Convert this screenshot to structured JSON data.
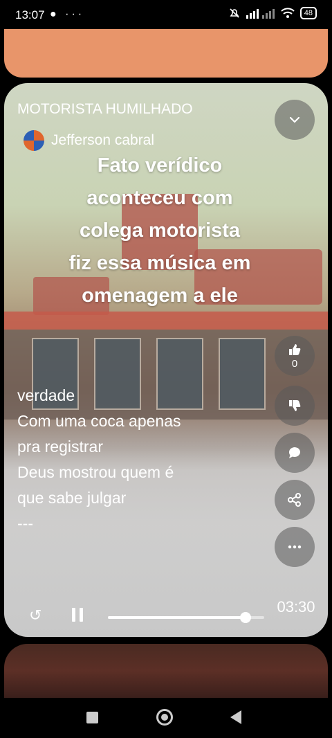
{
  "status": {
    "time": "13:07",
    "left_icons": "● ···",
    "battery": "48"
  },
  "card": {
    "title": "MOTORISTA HUMILHADO",
    "author": "Jefferson cabral",
    "overlay_lines": [
      "Fato verídico",
      "aconteceu com",
      "colega motorista",
      "fiz essa música em",
      "omenagem a ele"
    ],
    "lyrics_lines": [
      "verdade",
      "Com uma coca apenas",
      "pra registrar",
      "Deus mostrou quem é",
      "que sabe julgar",
      "---"
    ],
    "likes": "0",
    "time": "03:30",
    "progress": 0.88
  },
  "colors": {
    "prev_card": "#e8956a",
    "accent_white": "#ffffff"
  },
  "icons": [
    "chevron-down-icon",
    "thumbs-up-icon",
    "thumbs-down-icon",
    "comment-icon",
    "share-icon",
    "more-icon",
    "replay-icon",
    "pause-icon"
  ]
}
